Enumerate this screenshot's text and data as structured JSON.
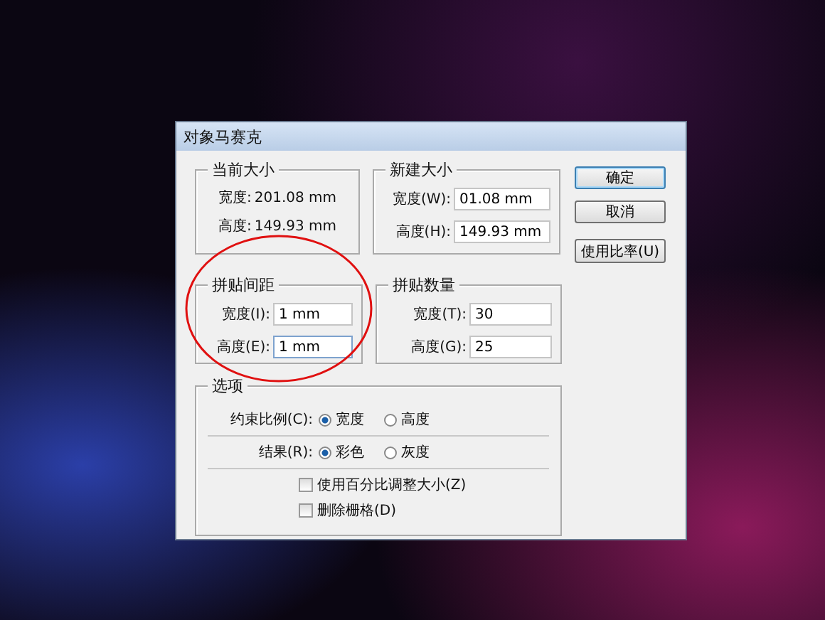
{
  "window": {
    "title": "对象马赛克"
  },
  "current_size": {
    "title": "当前大小",
    "rows": [
      {
        "label": "宽度:",
        "value": "201.08 mm"
      },
      {
        "label": "高度:",
        "value": "149.93 mm"
      }
    ]
  },
  "new_size": {
    "title": "新建大小",
    "fields": [
      {
        "label": "宽度(W):",
        "value": "01.08 mm",
        "focused": false
      },
      {
        "label": "高度(H):",
        "value": "149.93 mm",
        "focused": false
      }
    ]
  },
  "buttons": [
    {
      "label": "确定",
      "default": true
    },
    {
      "label": "取消",
      "default": false
    },
    {
      "label": "使用比率(U)",
      "default": false
    }
  ],
  "tile_spacing": {
    "title": "拼贴间距",
    "fields": [
      {
        "label": "宽度(I):",
        "value": "1 mm",
        "focused": false
      },
      {
        "label": "高度(E):",
        "value": "1 mm",
        "focused": true
      }
    ]
  },
  "tile_count": {
    "title": "拼贴数量",
    "fields": [
      {
        "label": "宽度(T):",
        "value": "30",
        "focused": false
      },
      {
        "label": "高度(G):",
        "value": "25",
        "focused": false
      }
    ]
  },
  "options": {
    "title": "选项",
    "radio_groups": [
      {
        "label": "约束比例(C):",
        "options": [
          {
            "label": "宽度",
            "selected": true
          },
          {
            "label": "高度",
            "selected": false
          }
        ]
      },
      {
        "label": "结果(R):",
        "options": [
          {
            "label": "彩色",
            "selected": true
          },
          {
            "label": "灰度",
            "selected": false
          }
        ]
      }
    ],
    "checkboxes": [
      {
        "label": "使用百分比调整大小(Z)",
        "checked": false
      },
      {
        "label": "删除栅格(D)",
        "checked": false
      }
    ]
  }
}
